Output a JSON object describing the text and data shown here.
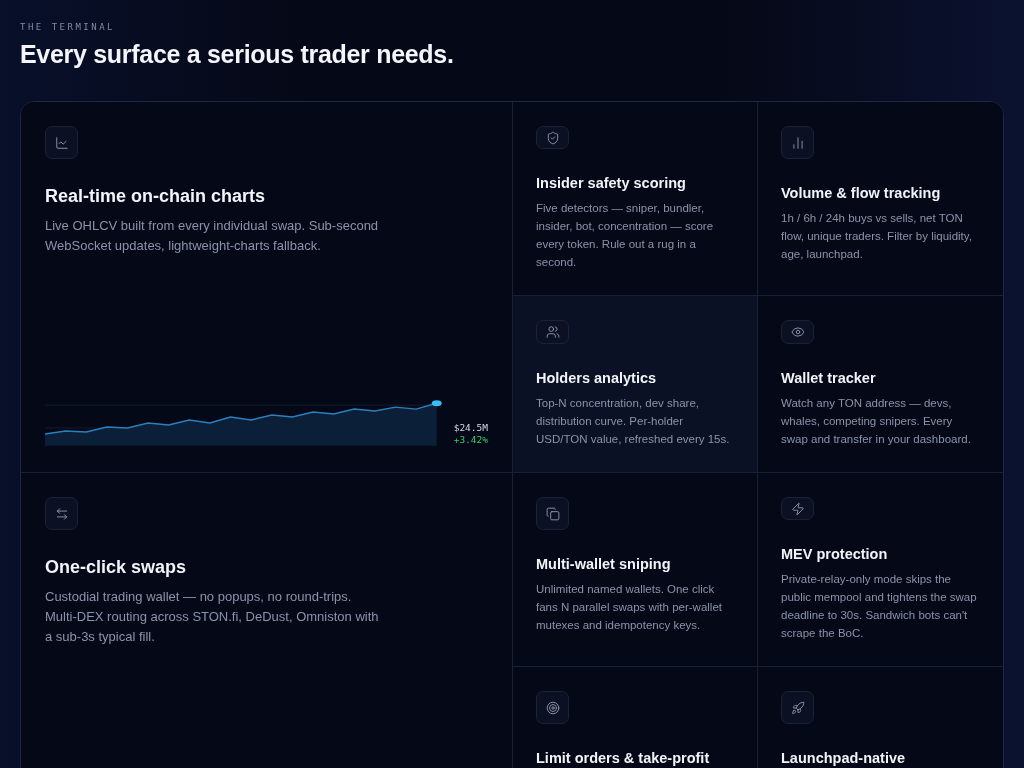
{
  "eyebrow": "THE TERMINAL",
  "heading": "Every surface a serious trader needs.",
  "features": [
    {
      "kind": "large",
      "title": "Real-time on-chain charts",
      "description": "Live OHLCV built from every individual swap. Sub-second WebSocket updates, lightweight-charts fallback.",
      "highlighted": false,
      "chart": {
        "value": "$24.5M",
        "change": "+3.42%"
      }
    },
    {
      "kind": "small",
      "title": "Insider safety scoring",
      "description": "Five detectors — sniper, bundler, insider, bot, concentration — score every token. Rule out a rug in a second.",
      "highlighted": false
    },
    {
      "kind": "small",
      "title": "Volume & flow tracking",
      "description": "1h / 6h / 24h buys vs sells, net TON flow, unique traders. Filter by liquidity, age, launchpad.",
      "highlighted": false
    },
    {
      "kind": "small",
      "title": "Holders analytics",
      "description": "Top-N concentration, dev share, distribution curve. Per-holder USD/TON value, refreshed every 15s.",
      "highlighted": true
    },
    {
      "kind": "small",
      "title": "Wallet tracker",
      "description": "Watch any TON address — devs, whales, competing snipers. Every swap and transfer in your dashboard.",
      "highlighted": false
    },
    {
      "kind": "large",
      "title": "One-click swaps",
      "description": "Custodial trading wallet — no popups, no round-trips. Multi-DEX routing across STON.fi, DeDust, Omniston with a sub-3s typical fill.",
      "highlighted": false
    },
    {
      "kind": "small",
      "title": "Multi-wallet sniping",
      "description": "Unlimited named wallets. One click fans N parallel swaps with per-wallet mutexes and idempotency keys.",
      "highlighted": false
    },
    {
      "kind": "small",
      "title": "MEV protection",
      "description": "Private-relay-only mode skips the public mempool and tightens the swap deadline to 30s. Sandwich bots can't scrape the BoC.",
      "highlighted": false
    },
    {
      "kind": "small",
      "title": "Limit orders & take-profit",
      "highlighted": false
    },
    {
      "kind": "small",
      "title": "Launchpad-native",
      "highlighted": false
    }
  ]
}
